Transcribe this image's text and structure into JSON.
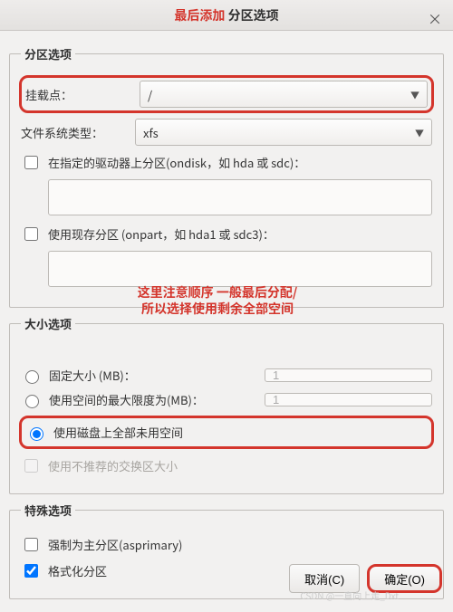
{
  "title": {
    "first": "最后添加",
    "rest": " 分区选项"
  },
  "close": "×",
  "groups": {
    "partition": {
      "legend": "分区选项",
      "mount_label": "挂载点：",
      "mount_value": "/",
      "fs_label": "文件系统类型：",
      "fs_value": "xfs",
      "ondisk_label": "在指定的驱动器上分区(ondisk，如 hda 或 sdc)：",
      "ondisk_value": "",
      "onpart_label": "使用现存分区 (onpart，如 hda1 或 sdc3)：",
      "onpart_value": ""
    },
    "size": {
      "legend": "大小选项",
      "fixed_label": "固定大小 (MB)：",
      "fixed_value": "1",
      "max_label": "使用空间的最大限度为(MB)：",
      "max_value": "1",
      "all_label": "使用磁盘上全部未用空间",
      "swap_label": "使用不推荐的交换区大小"
    },
    "special": {
      "legend": "特殊选项",
      "asprimary_label": "强制为主分区(asprimary)",
      "format_label": "格式化分区"
    }
  },
  "annotation": {
    "line1": "这里注意顺序 一般最后分配/",
    "line2": "所以选择使用剩余全部空间"
  },
  "buttons": {
    "cancel": "取消(C)",
    "ok": "确定(O)"
  },
  "watermark": "CSDN @一直向上走_Dxt"
}
